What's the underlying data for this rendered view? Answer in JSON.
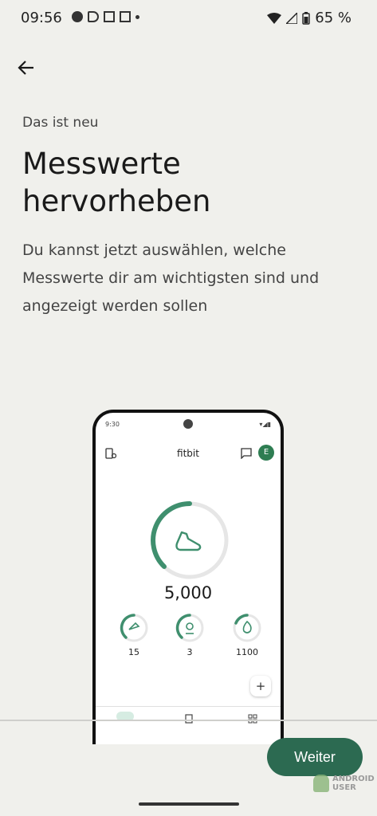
{
  "status_bar": {
    "time": "09:56",
    "battery": "65 %"
  },
  "header": {
    "eyebrow": "Das ist neu",
    "title_line1": "Messwerte",
    "title_line2": "hervorheben",
    "description": "Du kannst jetzt auswählen, welche Messwerte dir am wichtigsten sind und angezeigt werden sollen"
  },
  "phone_preview": {
    "status_time": "9:30",
    "app_name": "fitbit",
    "avatar_letter": "E",
    "steps_value": "5,000",
    "metrics": [
      {
        "icon": "zone-icon",
        "value": "15"
      },
      {
        "icon": "location-icon",
        "value": "3"
      },
      {
        "icon": "flame-icon",
        "value": "1100"
      }
    ],
    "accent": "#3f8f6e"
  },
  "footer": {
    "next_label": "Weiter"
  },
  "watermark": {
    "line1": "ANDROID",
    "line2": "USER"
  },
  "colors": {
    "background": "#f0f0ec",
    "primary_button": "#2c6a51"
  }
}
